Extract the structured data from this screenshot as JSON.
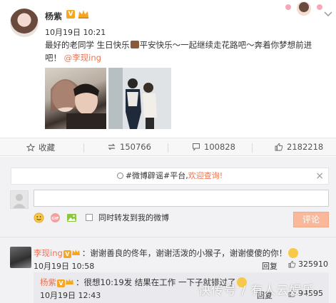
{
  "post": {
    "author": "杨紫",
    "datetime": "10月19日 10:21",
    "text_before_gift": "最好的老同学 生日快乐",
    "text_after_gift": "平安快乐～一起继续走花路吧～奔着你梦想前进吧！",
    "mention": "@李现ing"
  },
  "actions": {
    "favorite_label": "收藏",
    "repost_count": "150766",
    "comment_count": "100828",
    "like_count": "2182218"
  },
  "comment_box": {
    "notice_prefix": "#微博辟谣#平台,",
    "notice_link": "欢迎查询!",
    "forward_label": "同时转发到我的微博",
    "submit_label": "评论"
  },
  "comment": {
    "user": "李现ing",
    "text": "：谢谢善良的佟年，谢谢活泼的小猴子，谢谢傻傻的你！",
    "time": "10月19日 10:58",
    "reply_label": "回复",
    "like_count": "325910"
  },
  "reply": {
    "user": "杨紫",
    "text": "：很想10:19发 结果在工作 一下子就错过了",
    "time": "10月19日 12:43",
    "reply_label": "回复",
    "like_count": "94595"
  },
  "watermark": "快传号 / 有人云娱乐",
  "colors": {
    "accent": "#eb7350",
    "vip": "#f5a623",
    "submit_disabled": "#f9b89a"
  }
}
